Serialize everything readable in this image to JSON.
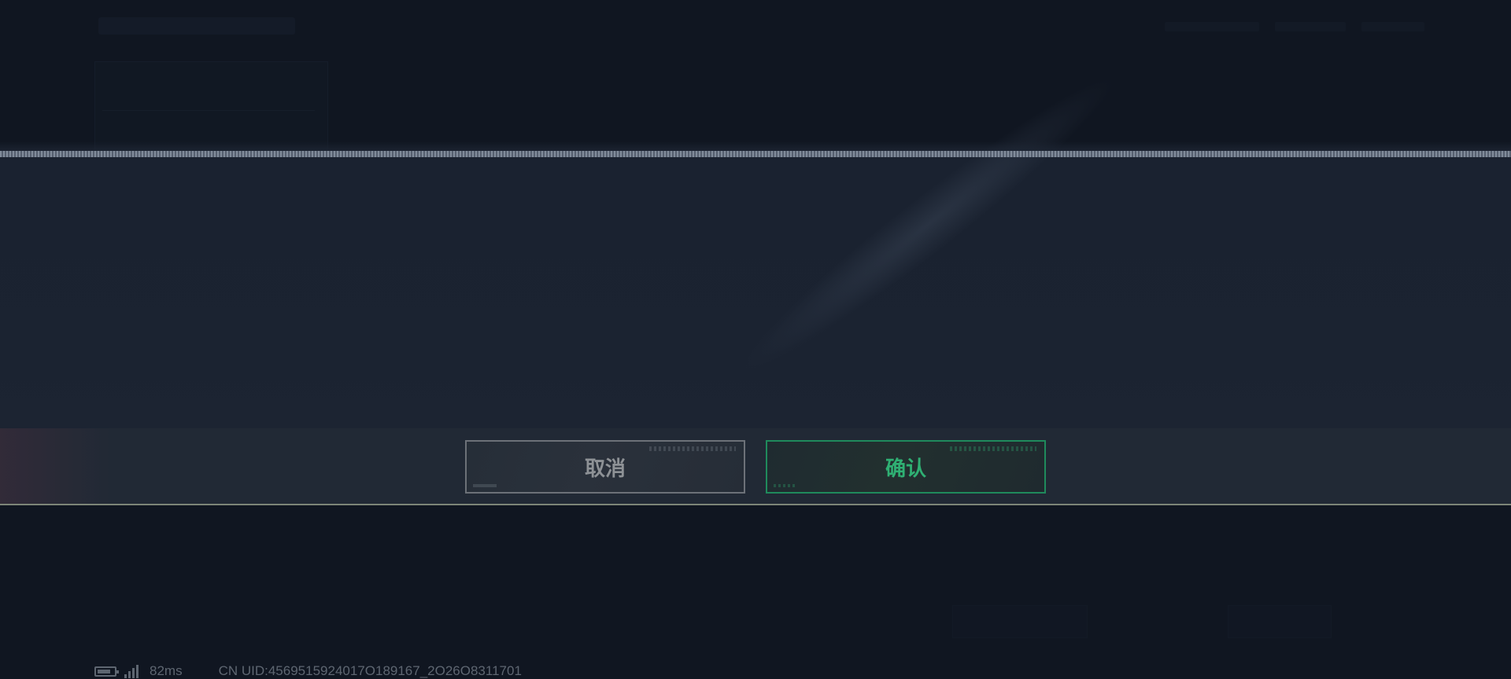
{
  "dialog": {
    "cancel_label": "取消",
    "confirm_label": "确认"
  },
  "status_bar": {
    "ping": "82ms",
    "uid": "CN UID:4569515924017O189167_2O26O8311701"
  },
  "colors": {
    "confirm_accent": "#2fb073",
    "cancel_text": "#8e9296",
    "background": "#101621"
  },
  "icons": {
    "battery": "battery-icon",
    "signal": "signal-icon"
  }
}
